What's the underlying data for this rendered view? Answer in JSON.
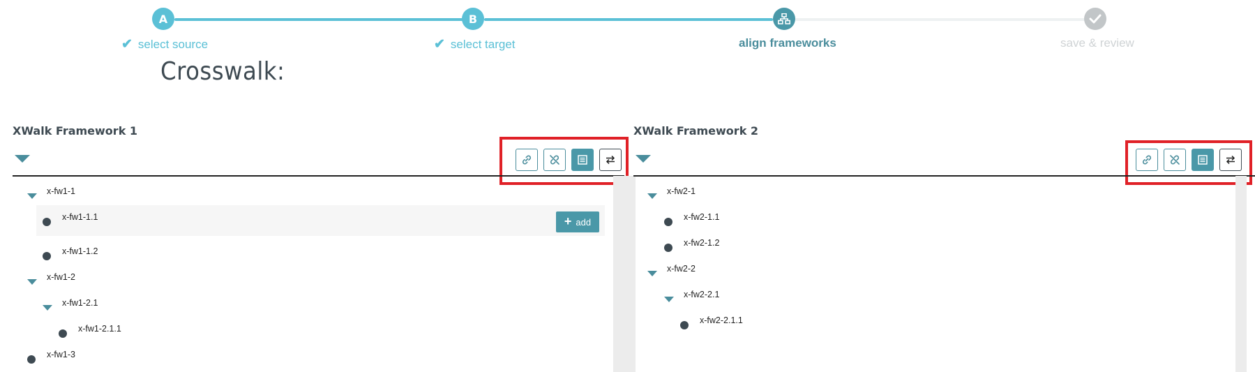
{
  "stepper": {
    "steps": [
      {
        "badge": "A",
        "label": "select source",
        "state": "done"
      },
      {
        "badge": "B",
        "label": "select target",
        "state": "done"
      },
      {
        "badge": "",
        "label": "align frameworks",
        "state": "current",
        "icon": "sitemap-icon"
      },
      {
        "badge": "",
        "label": "save & review",
        "state": "future",
        "icon": "check-icon"
      }
    ]
  },
  "page": {
    "title": "Crosswalk:"
  },
  "panels": {
    "left": {
      "title": "XWalk Framework 1",
      "toolbar": [
        "link-icon",
        "unlink-icon",
        "list-icon",
        "swap-icon"
      ],
      "nodes": [
        {
          "label": "x-fw1-1",
          "type": "branch"
        },
        {
          "label": "x-fw1-1.1",
          "type": "leaf"
        },
        {
          "label": "x-fw1-1.2",
          "type": "leaf"
        },
        {
          "label": "x-fw1-2",
          "type": "branch"
        },
        {
          "label": "x-fw1-2.1",
          "type": "branch"
        },
        {
          "label": "x-fw1-2.1.1",
          "type": "leaf"
        },
        {
          "label": "x-fw1-3",
          "type": "leaf"
        }
      ],
      "add_label": "add"
    },
    "right": {
      "title": "XWalk Framework 2",
      "toolbar": [
        "link-icon",
        "unlink-icon",
        "list-icon",
        "swap-icon"
      ],
      "nodes": [
        {
          "label": "x-fw2-1",
          "type": "branch"
        },
        {
          "label": "x-fw2-1.1",
          "type": "leaf"
        },
        {
          "label": "x-fw2-1.2",
          "type": "leaf"
        },
        {
          "label": "x-fw2-2",
          "type": "branch"
        },
        {
          "label": "x-fw2-2.1",
          "type": "branch"
        },
        {
          "label": "x-fw2-2.1.1",
          "type": "leaf"
        }
      ]
    }
  },
  "colors": {
    "step_done": "#5bc0d6",
    "step_current": "#4a98a8",
    "accent": "#4a8d9c",
    "highlight": "#e02127"
  }
}
